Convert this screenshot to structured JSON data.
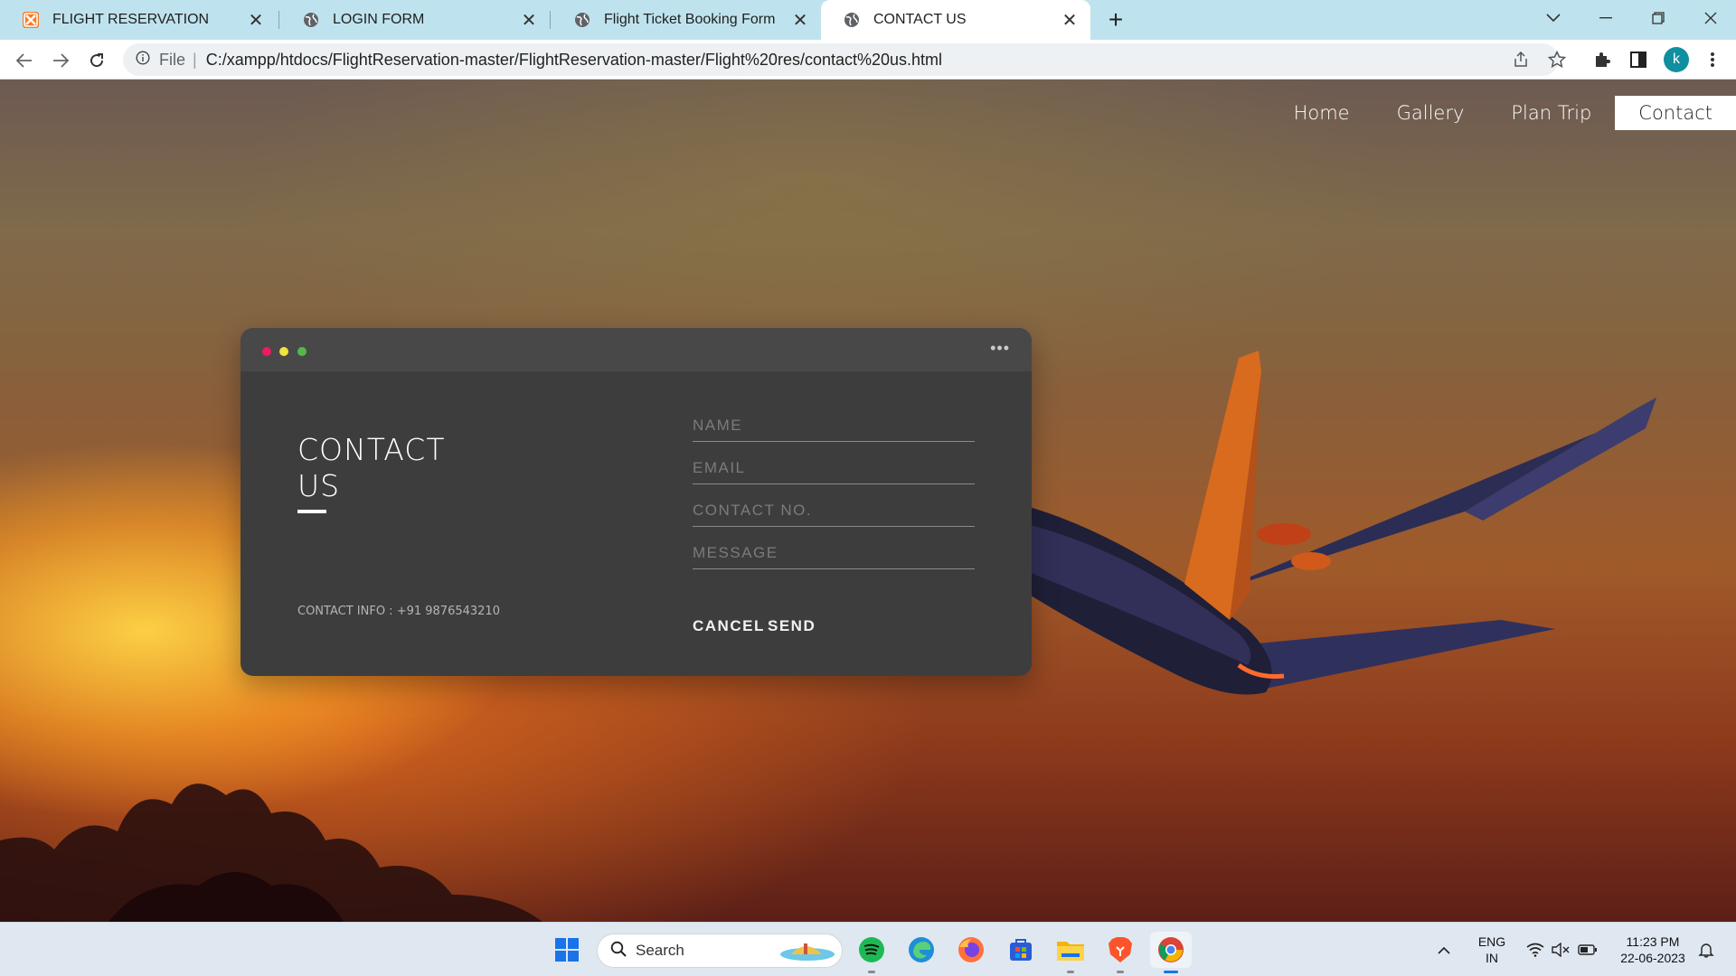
{
  "browser": {
    "tabs": [
      {
        "title": "FLIGHT RESERVATION",
        "icon": "xampp-icon",
        "active": false
      },
      {
        "title": "LOGIN FORM",
        "icon": "globe-icon",
        "active": false
      },
      {
        "title": "Flight Ticket Booking Form",
        "icon": "globe-icon",
        "active": false
      },
      {
        "title": "CONTACT US",
        "icon": "globe-icon",
        "active": true
      }
    ],
    "address": {
      "scheme_label": "File",
      "url": "C:/xampp/htdocs/FlightReservation-master/FlightReservation-master/Flight%20res/contact%20us.html"
    },
    "profile_initial": "k"
  },
  "site": {
    "nav": [
      {
        "label": "Home",
        "active": false
      },
      {
        "label": "Gallery",
        "active": false
      },
      {
        "label": "Plan Trip",
        "active": false
      },
      {
        "label": "Contact",
        "active": true
      }
    ],
    "contact_card": {
      "title_line1": "CONTACT",
      "title_line2": "US",
      "contact_info": "CONTACT INFO : +91 9876543210",
      "fields": {
        "name_placeholder": "NAME",
        "email_placeholder": "EMAIL",
        "contact_placeholder": "CONTACT NO.",
        "message_placeholder": "MESSAGE"
      },
      "cancel_label": "CANCEL",
      "send_label": "SEND",
      "dot_colors": [
        "#ed1c5c",
        "#f1e33a",
        "#53b84d"
      ]
    }
  },
  "taskbar": {
    "search_label": "Search",
    "language": "ENG",
    "region": "IN",
    "time": "11:23 PM",
    "date": "22-06-2023"
  }
}
